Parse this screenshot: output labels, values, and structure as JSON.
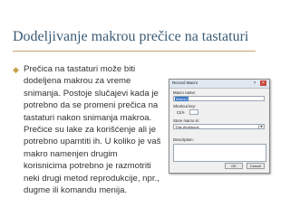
{
  "slide": {
    "title": "Dodeljivanje makrou prečice na tastaturi",
    "bullet_icon": "diamond-bullet-icon",
    "bullet_lines": [
      "Prečica na tastaturi može biti",
      "dodeljena makrou za vreme",
      "snimanja.  Postoje slučajevi kada je",
      "potrebno da se promeni prečica na",
      "tastaturi nakon snimanja makroa.",
      "Prečice su lake za korišćenje ali je",
      "potrebno upamtiti ih. U koliko je vaš",
      "makro  namenjen drugim",
      "korisnicima potrebno je razmotriti",
      "neki drugi metod reprodukcije, npr.,",
      "dugme ili komandu menija."
    ]
  },
  "dialog": {
    "title": "Record Macro",
    "help_label": "?",
    "close_label": "×",
    "macro_name_label": "Macro name:",
    "macro_name_value": "Macro1",
    "shortcut_label": "Shortcut key:",
    "shortcut_prefix": "Ctrl+",
    "store_label": "Store macro in:",
    "store_value": "This Workbook",
    "description_label": "Description:",
    "ok_label": "OK",
    "cancel_label": "Cancel"
  }
}
